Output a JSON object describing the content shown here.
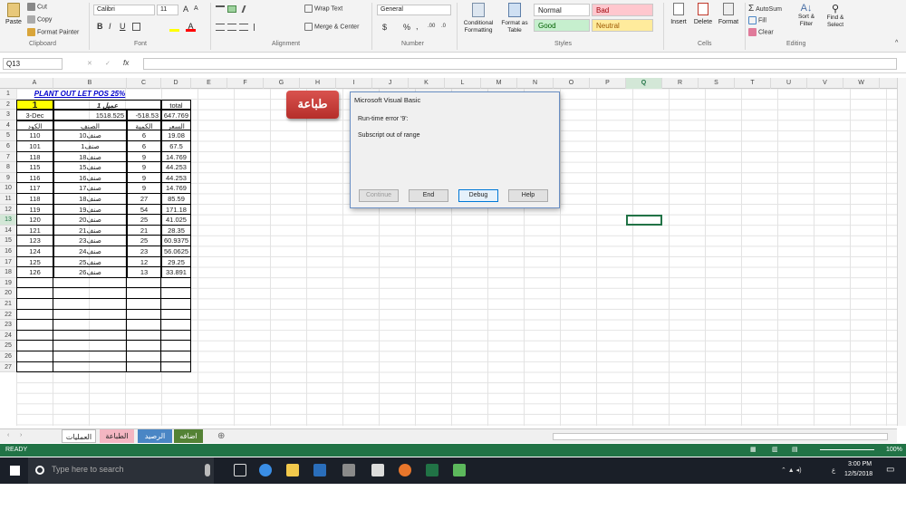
{
  "ribbon": {
    "clipboard": {
      "paste": "Paste",
      "cut": "Cut",
      "copy": "Copy",
      "format_painter": "Format Painter",
      "group": "Clipboard"
    },
    "font": {
      "name": "Calibri",
      "size": "11",
      "bold": "B",
      "italic": "I",
      "underline": "U",
      "grow": "A",
      "shrink": "A",
      "group": "Font"
    },
    "alignment": {
      "wrap": "Wrap Text",
      "merge": "Merge & Center",
      "group": "Alignment"
    },
    "number": {
      "format": "General",
      "currency": "$",
      "percent": "%",
      "comma": ",",
      "inc_dec": ".00",
      "dec_dec": ".0",
      "group": "Number"
    },
    "styles": {
      "conditional": "Conditional Formatting",
      "format_table": "Format as Table",
      "normal": "Normal",
      "bad": "Bad",
      "good": "Good",
      "neutral": "Neutral",
      "group": "Styles"
    },
    "cells": {
      "insert": "Insert",
      "delete": "Delete",
      "format": "Format",
      "group": "Cells"
    },
    "editing": {
      "autosum": "AutoSum",
      "fill": "Fill",
      "clear": "Clear",
      "sort": "Sort & Filter",
      "find": "Find & Select",
      "group": "Editing"
    }
  },
  "formula_bar": {
    "name_box": "Q13",
    "fx": "fx",
    "content": ""
  },
  "columns": [
    "A",
    "B",
    "C",
    "D",
    "E",
    "F",
    "G",
    "H",
    "I",
    "J",
    "K",
    "L",
    "M",
    "N",
    "O",
    "P",
    "Q",
    "R",
    "S",
    "T",
    "U",
    "V",
    "W"
  ],
  "rows": [
    "1",
    "2",
    "3",
    "4",
    "5",
    "6",
    "7",
    "8",
    "9",
    "10",
    "11",
    "12",
    "13",
    "14",
    "15",
    "16",
    "17",
    "18",
    "19",
    "20",
    "21",
    "22",
    "23",
    "24",
    "25",
    "26",
    "27"
  ],
  "sheet": {
    "title": "PLANT OUT LET POS 25%",
    "r2_a": "1",
    "r2_b": "عميل 1",
    "r2_d": "total",
    "r3_a": "3-Dec",
    "r3_b": "1518.525",
    "r3_c": "-518.53",
    "r3_d": "647.769",
    "headers": [
      "الكود",
      "الصنف",
      "الكمية",
      "السعر"
    ],
    "data": [
      [
        "110",
        "صنف10",
        "6",
        "19.08"
      ],
      [
        "101",
        "صنف1",
        "6",
        "67.5"
      ],
      [
        "118",
        "صنف18",
        "9",
        "14.769"
      ],
      [
        "115",
        "صنف15",
        "9",
        "44.253"
      ],
      [
        "116",
        "صنف16",
        "9",
        "44.253"
      ],
      [
        "117",
        "صنف17",
        "9",
        "14.769"
      ],
      [
        "118",
        "صنف18",
        "27",
        "85.59"
      ],
      [
        "119",
        "صنف19",
        "54",
        "171.18"
      ],
      [
        "120",
        "صنف20",
        "25",
        "41.025"
      ],
      [
        "121",
        "صنف21",
        "21",
        "28.35"
      ],
      [
        "123",
        "صنف23",
        "25",
        "60.9375"
      ],
      [
        "124",
        "صنف24",
        "23",
        "56.0625"
      ],
      [
        "125",
        "صنف25",
        "12",
        "29.25"
      ],
      [
        "126",
        "صنف26",
        "13",
        "33.891"
      ]
    ]
  },
  "print_button": "طباعة",
  "dialog": {
    "title": "Microsoft Visual Basic",
    "error": "Run-time error '9':",
    "message": "Subscript out of range",
    "continue": "Continue",
    "end": "End",
    "debug": "Debug",
    "help": "Help"
  },
  "tabs": [
    "العمليات",
    "الطباعة",
    "الرصيد",
    "اضافه"
  ],
  "status": {
    "mode": "READY",
    "zoom": "100%"
  },
  "taskbar": {
    "search": "Type here to search",
    "time": "3:00 PM",
    "date": "12/5/2018",
    "lang": "ع"
  },
  "colors": {
    "excel_green": "#217346",
    "tab_pink": "#f4b6c2",
    "tab_blue": "#4a86c5",
    "tab_green": "#548235",
    "title_blue": "#0000cc",
    "yellow": "#ffff00",
    "print_red": "#c0392b"
  }
}
